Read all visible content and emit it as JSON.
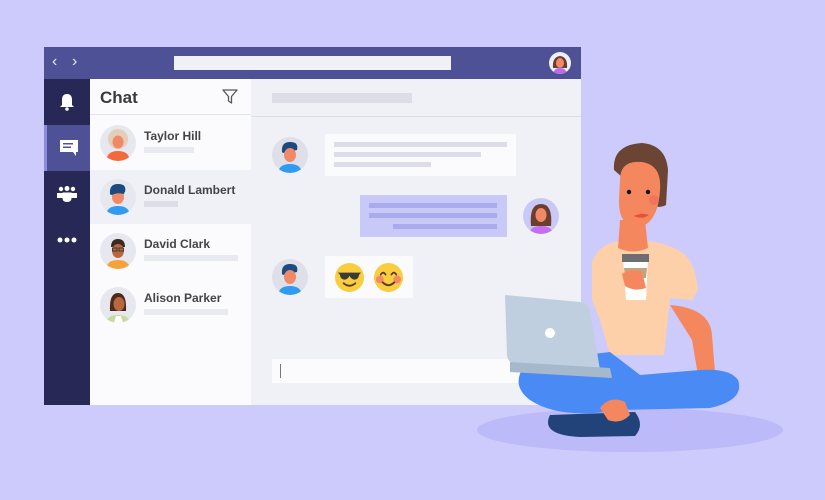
{
  "window": {
    "nav": {
      "back_icon": "‹",
      "forward_icon": "›"
    },
    "search_placeholder": "",
    "user_avatar": "user-avatar-woman-purple"
  },
  "rail": {
    "items": [
      {
        "name": "activity",
        "icon": "bell-icon",
        "active": false
      },
      {
        "name": "chat",
        "icon": "chat-icon",
        "active": true
      },
      {
        "name": "teams",
        "icon": "teams-icon",
        "active": false
      },
      {
        "name": "more",
        "icon": "more-icon",
        "active": false
      }
    ]
  },
  "chat_list": {
    "title": "Chat",
    "filter_icon": "filter-icon",
    "contacts": [
      {
        "name": "Taylor Hill",
        "selected": false
      },
      {
        "name": "Donald Lambert",
        "selected": true
      },
      {
        "name": "David Clark",
        "selected": false
      },
      {
        "name": "Alison Parker",
        "selected": false
      }
    ]
  },
  "conversation": {
    "title": "",
    "messages": [
      {
        "from": "Donald Lambert",
        "mine": false,
        "kind": "text"
      },
      {
        "from": "me",
        "mine": true,
        "kind": "text"
      },
      {
        "from": "Donald Lambert",
        "mine": false,
        "kind": "emoji",
        "emojis": [
          "😎",
          "😊"
        ]
      }
    ],
    "composer": {
      "value": "",
      "placeholder": ""
    }
  },
  "colors": {
    "background": "#cccbfb",
    "titlebar": "#4f5196",
    "rail": "#272855",
    "rail_active": "#4f5196",
    "own_bubble": "#c9c9f8",
    "emoji_yellow": "#f9cd3e"
  }
}
